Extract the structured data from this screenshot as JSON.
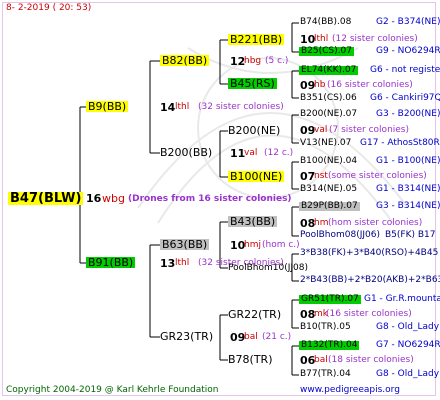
{
  "header": {
    "date": "8- 2-2019 ( 20: 53)"
  },
  "root": {
    "label": "B47(BLW)",
    "year": "16",
    "mark": "wbg",
    "note": "(Drones from 16 sister colonies)"
  },
  "gen2": {
    "top": {
      "label": "B9(BB)",
      "year": "14",
      "mark": "lthl",
      "note": "(32 sister colonies)"
    },
    "bottom": {
      "label": "B91(BB)",
      "year": "13",
      "mark": "lthl",
      "note": "(32 sister colonies)"
    }
  },
  "gen3": {
    "a": {
      "label": "B82(BB)",
      "year": "12",
      "mark": "hbg",
      "note": "(5 c.)"
    },
    "b": {
      "label": "B200(BB)",
      "year": "11",
      "mark": "val",
      "note": "(12 c.)"
    },
    "c": {
      "label": "B63(BB)",
      "year": "10",
      "mark": "hmj",
      "note": "(hom c.)"
    },
    "d": {
      "label": "GR23(TR)",
      "year": "09",
      "mark": "bal",
      "note": "(21 c.)"
    }
  },
  "gen4": {
    "a": {
      "label": "B221(BB)",
      "year": "10",
      "mark": "lthl",
      "note": "(12 sister colonies)"
    },
    "b": {
      "label": "B45(RS)",
      "year": "09",
      "mark": "hb",
      "note": "(16 sister colonies)"
    },
    "c": {
      "label": "B200(NE)",
      "year": "09",
      "mark": "val",
      "note": "(7 sister colonies)"
    },
    "d": {
      "label": "B100(NE)",
      "year": "07",
      "mark": "nst",
      "note": "(some sister colonies)"
    },
    "e": {
      "label": "B43(BB)",
      "year": "08",
      "mark": "hm",
      "note": "(hom sister colonies)"
    },
    "f": {
      "label": "PoolBhom10(JJ08)"
    },
    "g": {
      "label": "GR22(TR)",
      "year": "08",
      "mark": "mk",
      "note": "(16 sister colonies)"
    },
    "h": {
      "label": "B78(TR)",
      "year": "06",
      "mark": "bal",
      "note": "(18 sister colonies)"
    }
  },
  "gen5": [
    {
      "label": "B74(BB).08",
      "code": "G2 - B374(NE)"
    },
    {
      "label": "B25(CS).07",
      "code": "G9 - NO6294R"
    },
    {
      "label": "EL74(KK).07",
      "code": "G6 - not registe"
    },
    {
      "label": "B351(CS).06",
      "code": "G6 - Cankiri97Q"
    },
    {
      "label": "B200(NE).07",
      "code": "G3 - B200(NE)"
    },
    {
      "label": "V13(NE).07",
      "code": "G17 - AthosSt80R"
    },
    {
      "label": "B100(NE).04",
      "code": "G1 - B100(NE)"
    },
    {
      "label": "B314(NE).05",
      "code": "G1 - B314(NE)"
    },
    {
      "label": "B29P(BB).07",
      "code": "G3 - B314(NE)"
    },
    {
      "label": "PoolBhom08(JJ06)",
      "code": "B5(FK) B17"
    },
    {
      "label": "3*B38(FK)+3*B40(RSO)+4B45",
      "code": ""
    },
    {
      "label": "2*B43(BB)+2*B20(AKB)+2*B63",
      "code": ""
    },
    {
      "label": "GR51(TR).07",
      "code": "G1 - Gr.R.mounta"
    },
    {
      "label": "B10(TR).05",
      "code": "G8 - Old_Lady"
    },
    {
      "label": "B132(TR).04",
      "code": "G7 - NO6294R"
    },
    {
      "label": "B77(TR).04",
      "code": "G8 - Old_Lady"
    }
  ],
  "footer": {
    "copyright": "Copyright 2004-2019 @ Karl Kehrle Foundation",
    "site": "www.pedigreeapis.org"
  }
}
